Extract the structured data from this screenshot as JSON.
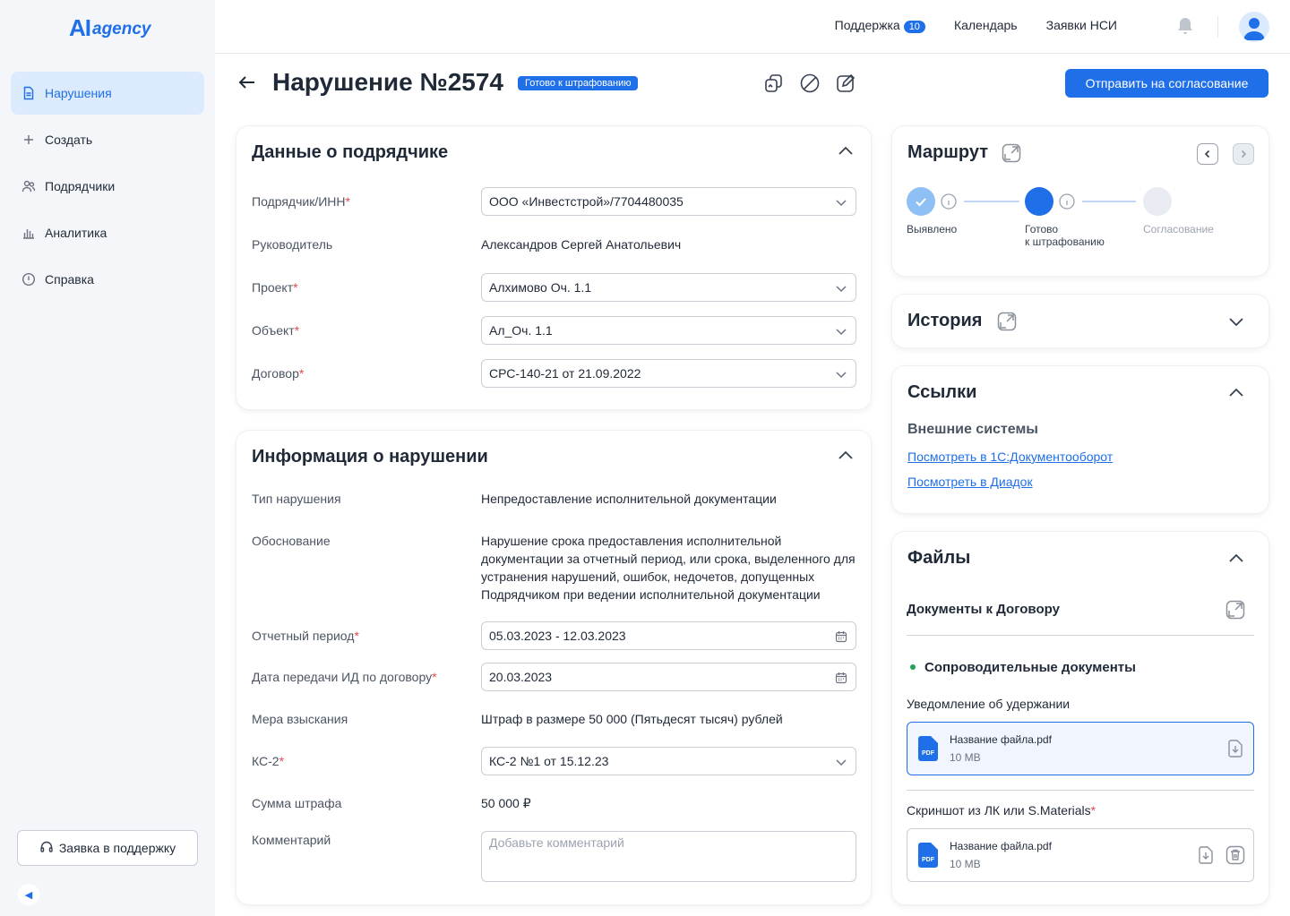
{
  "brand": {
    "logo_mark": "AI",
    "logo_word": "agency"
  },
  "sidebar": {
    "items": [
      {
        "label": "Нарушения",
        "icon": "document-icon"
      },
      {
        "label": "Создать",
        "icon": "plus-icon"
      },
      {
        "label": "Подрядчики",
        "icon": "users-icon"
      },
      {
        "label": "Аналитика",
        "icon": "bar-chart-icon"
      },
      {
        "label": "Справка",
        "icon": "info-circle-icon"
      }
    ],
    "support_button": "Заявка в поддержку"
  },
  "topbar": {
    "support": "Поддержка",
    "support_count": "10",
    "calendar": "Календарь",
    "nsi": "Заявки НСИ"
  },
  "header": {
    "title": "Нарушение №2574",
    "status": "Готово к штрафованию",
    "submit_button": "Отправить на согласование"
  },
  "contractor": {
    "title": "Данные о подрядчике",
    "fields": {
      "contractor_label": "Подрядчик/ИНН",
      "contractor_value": "ООО «Инвестстрой»/7704480035",
      "head_label": "Руководитель",
      "head_value": "Александров Сергей Анатольевич",
      "project_label": "Проект",
      "project_value": "Алхимово Оч. 1.1",
      "object_label": "Объект",
      "object_value": "Ал_Оч. 1.1",
      "contract_label": "Договор",
      "contract_value": "СРС-140-21 от 21.09.2022"
    }
  },
  "violation": {
    "title": "Информация о нарушении",
    "type_label": "Тип нарушения",
    "type_value": "Непредоставление исполнительной документации",
    "reason_label": "Обоснование",
    "reason_value": "Нарушение срока предоставления исполнительной документации за отчетный период, или срока, выделенного для устранения нарушений, ошибок, недочетов, допущенных Подрядчиком при ведении исполнительной документации",
    "period_label": "Отчетный период",
    "period_value": "05.03.2023 - 12.03.2023",
    "handover_label": "Дата передачи ИД по договору",
    "handover_value": "20.03.2023",
    "measure_label": "Мера взыскания",
    "measure_value": "Штраф в размере 50 000 (Пятьдесят тысяч) рублей",
    "ks2_label": "КС-2",
    "ks2_value": "КС-2 №1 от 15.12.23",
    "fine_label": "Сумма штрафа",
    "fine_value": "50 000 ₽",
    "comment_label": "Комментарий",
    "comment_placeholder": "Добавьте комментарий"
  },
  "route": {
    "title": "Маршрут",
    "steps": [
      {
        "label_line1": "Выявлено",
        "label_line2": "",
        "state": "done"
      },
      {
        "label_line1": "Готово",
        "label_line2": "к штрафованию",
        "state": "current"
      },
      {
        "label_line1": "Согласование",
        "label_line2": "",
        "state": "pending"
      }
    ]
  },
  "history": {
    "title": "История"
  },
  "links": {
    "title": "Ссылки",
    "subtitle": "Внешние системы",
    "link1": "Посмотреть в 1С:Документооборот",
    "link2": "Посмотреть в Диадок"
  },
  "files": {
    "title": "Файлы",
    "contract_docs": "Документы к Договору",
    "accompanying": "Сопроводительные документы",
    "notice_label": "Уведомление об удержании",
    "screenshot_label": "Скриншот из ЛК или S.Materials",
    "file1_name": "Название файла.pdf",
    "file1_size": "10 MB",
    "file2_name": "Название файла.pdf",
    "file2_size": "10 MB",
    "pdf_tag": "PDF"
  },
  "colors": {
    "accent": "#1e6fe8",
    "required": "#e5484d",
    "sidebar_bg": "#f4f6fa"
  }
}
